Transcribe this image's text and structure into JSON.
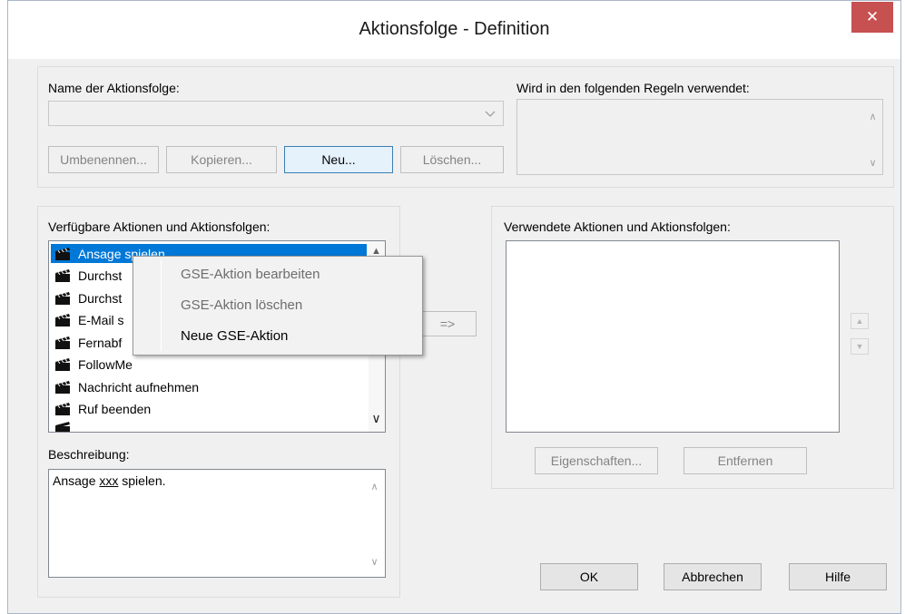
{
  "window": {
    "title": "Aktionsfolge - Definition",
    "close_glyph": "✕"
  },
  "name_section": {
    "label": "Name der Aktionsfolge:",
    "combo_value": "",
    "buttons": {
      "rename": "Umbenennen...",
      "copy": "Kopieren...",
      "new": "Neu...",
      "delete": "Löschen..."
    }
  },
  "used_in": {
    "label": "Wird in den folgenden Regeln verwendet:"
  },
  "available": {
    "label": "Verfügbare Aktionen und Aktionsfolgen:",
    "items": [
      {
        "label": "Ansage spielen",
        "icon": "clapperboard-icon",
        "selected": true
      },
      {
        "label": "Durchst",
        "icon": "clapperboard-icon"
      },
      {
        "label": "Durchst",
        "icon": "clapperboard-icon"
      },
      {
        "label": "E-Mail s",
        "icon": "clapperboard-icon"
      },
      {
        "label": "Fernabf",
        "icon": "clapperboard-icon"
      },
      {
        "label": "FollowMe",
        "icon": "clapperboard-icon"
      },
      {
        "label": "Nachricht aufnehmen",
        "icon": "clapperboard-icon"
      },
      {
        "label": "Ruf beenden",
        "icon": "clapperboard-icon"
      }
    ]
  },
  "description": {
    "label": "Beschreibung:",
    "text_before": "Ansage ",
    "text_underlined": "xxx",
    "text_after": " spielen."
  },
  "add_button": "=>",
  "used_actions": {
    "label": "Verwendete Aktionen und Aktionsfolgen:",
    "buttons": {
      "properties": "Eigenschaften...",
      "remove": "Entfernen"
    }
  },
  "footer": {
    "ok": "OK",
    "cancel": "Abbrechen",
    "help": "Hilfe"
  },
  "context_menu": {
    "items": [
      {
        "label": "GSE-Aktion bearbeiten",
        "enabled": false
      },
      {
        "label": "GSE-Aktion löschen",
        "enabled": false
      },
      {
        "label": "Neue GSE-Aktion",
        "enabled": true
      }
    ]
  },
  "colors": {
    "selection": "#0078d7",
    "close_button": "#c75050",
    "dialog_bg": "#f0f0f0"
  }
}
